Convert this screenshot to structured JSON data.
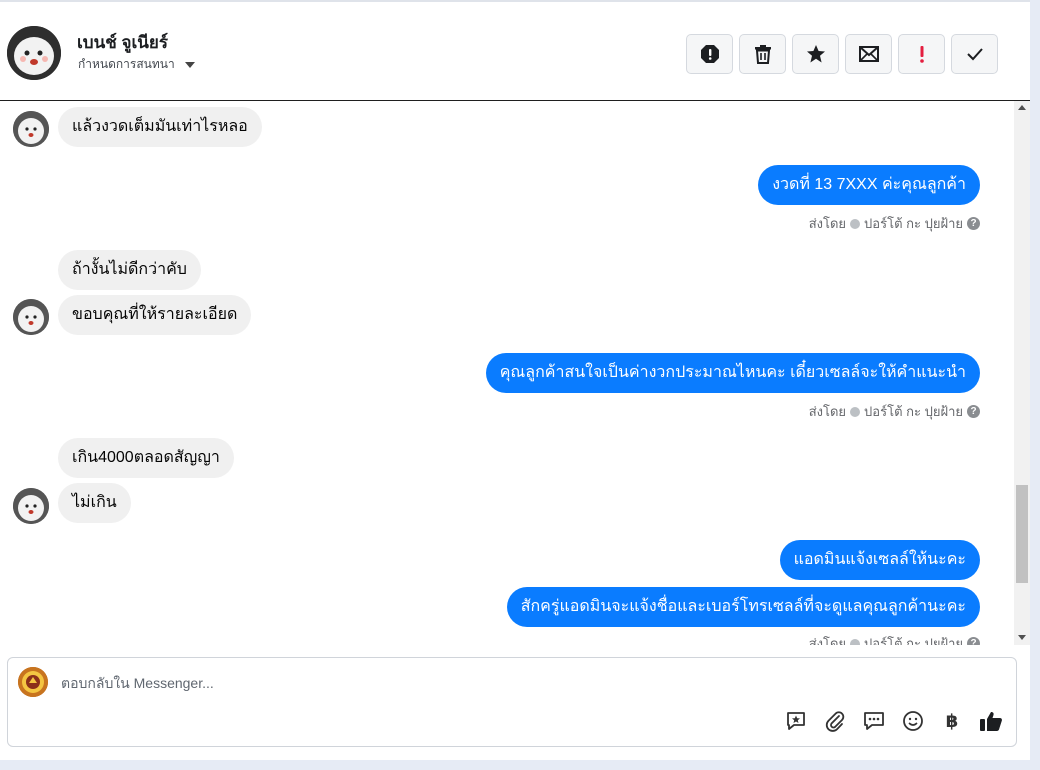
{
  "header": {
    "contact_name": "เบนช์ จูเนียร์",
    "conversation_setting": "กำหนดการสนทนา"
  },
  "actions": [
    {
      "name": "mark-spam-button",
      "icon": "alert-circle-icon"
    },
    {
      "name": "delete-button",
      "icon": "trash-icon"
    },
    {
      "name": "star-button",
      "icon": "star-icon"
    },
    {
      "name": "mark-unread-button",
      "icon": "envelope-icon"
    },
    {
      "name": "follow-up-button",
      "icon": "exclamation-icon"
    },
    {
      "name": "mark-done-button",
      "icon": "check-icon"
    }
  ],
  "messages": {
    "m1": "แล้วงวดเต็มมันเท่าไรหลอ",
    "m2": "งวดที่ 13 7XXX  ค่ะคุณลูกค้า",
    "m3": "ถ้างั้นไม่ดีกว่าคับ",
    "m4": "ขอบคุณที่ให้รายละเอียด",
    "m5": "คุณลูกค้าสนใจเป็นค่างวกประมาณไหนคะ เดี๋ยวเซลล์จะให้คำแนะนำ",
    "m6": "เกิน4000ตลอดสัญญา",
    "m7": "ไม่เกิน",
    "m8": "แอดมินแจ้งเซลล์ให้นะคะ",
    "m9": "สักครู่แอดมินจะแจ้งชื่อและเบอร์โทรเซลล์ที่จะดูแลคุณลูกค้านะคะ"
  },
  "sent_meta": {
    "prefix": "ส่งโดย",
    "sender": "ปอร์โต้ กะ ปุยฝ้าย",
    "help": "?"
  },
  "composer": {
    "placeholder": "ตอบกลับใน Messenger...",
    "baht_symbol": "฿"
  },
  "colors": {
    "outgoing_bubble": "#0a7cff",
    "incoming_bubble": "#f0f0f0",
    "follow_up_red": "#e41e3f"
  }
}
